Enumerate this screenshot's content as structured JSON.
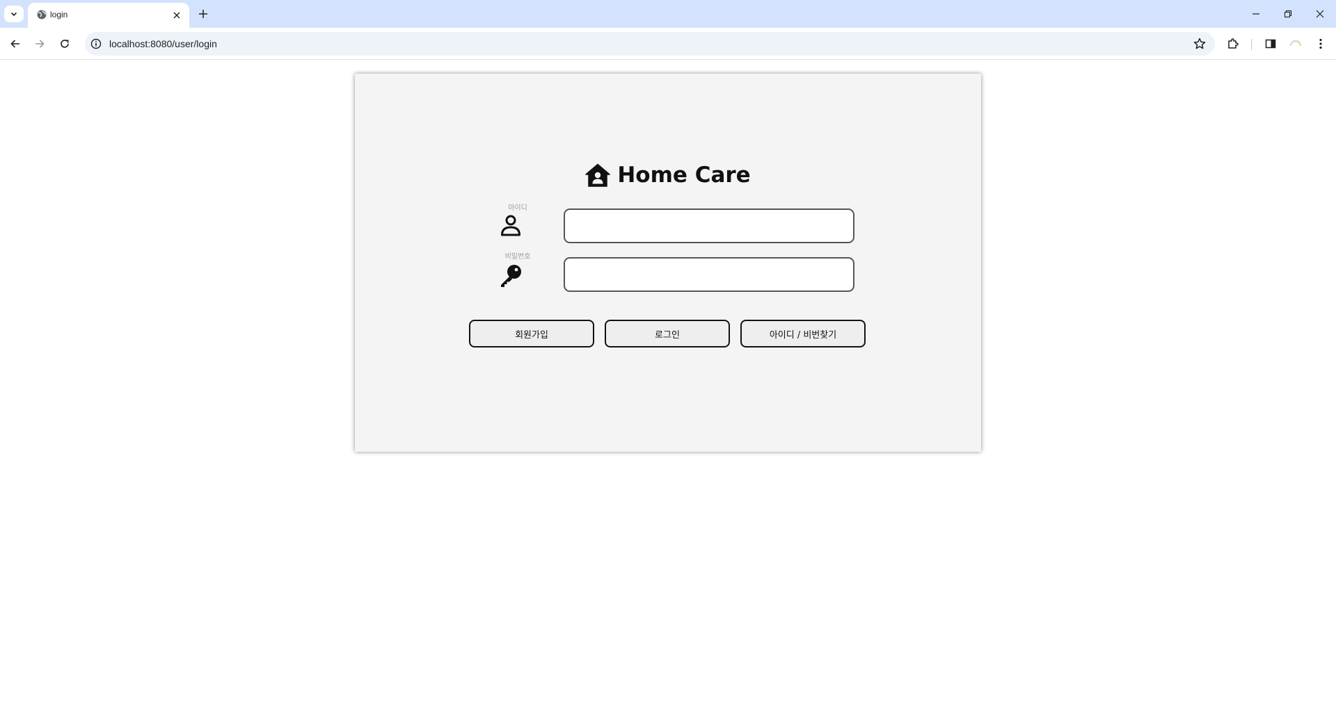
{
  "browser": {
    "tab_title": "login",
    "url": "localhost:8080/user/login",
    "icons": {
      "tab_list": "chevron-down-icon",
      "favicon": "globe-icon",
      "tab_close": "close-icon",
      "new_tab": "plus-icon",
      "back": "arrow-left-icon",
      "forward": "arrow-right-icon",
      "reload": "reload-icon",
      "site_info": "info-icon",
      "bookmark": "star-icon",
      "extensions": "puzzle-icon",
      "side_panel": "side-panel-icon",
      "profile": "profile-icon",
      "menu": "kebab-menu-icon",
      "minimize": "minimize-icon",
      "restore": "restore-icon",
      "close_window": "close-icon"
    }
  },
  "login": {
    "brand_title": "Home Care",
    "brand_icon": "house-user-icon",
    "id_label": "아이디",
    "id_icon": "user-icon",
    "id_value": "",
    "password_label": "비밀번호",
    "password_icon": "key-icon",
    "password_value": "",
    "buttons": {
      "signup": "회원가입",
      "login": "로그인",
      "find": "아이디 / 비번찾기"
    }
  },
  "colors": {
    "tabbar_bg": "#d3e3fd",
    "card_bg": "#f4f4f4",
    "button_bg": "#eeeeee",
    "text": "#111111",
    "label_gray": "#9a9a9a"
  }
}
